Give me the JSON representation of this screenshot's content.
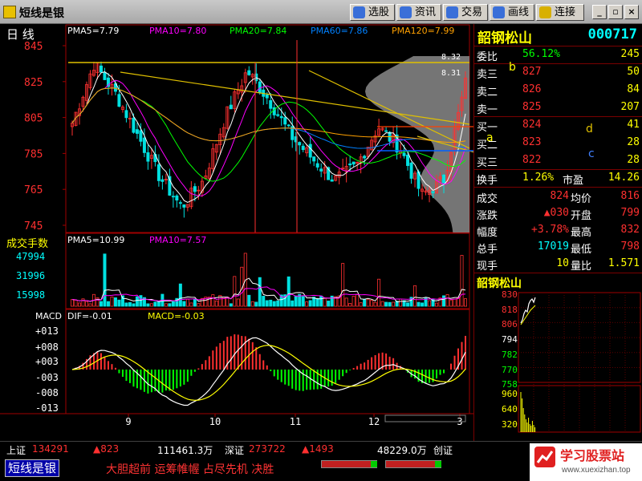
{
  "app": {
    "title": "短线是银"
  },
  "toolbar": {
    "buttons": [
      {
        "label": "选股",
        "icon": "stock-picker-icon",
        "color": "#3a6fd8"
      },
      {
        "label": "资讯",
        "icon": "news-icon",
        "color": "#3a6fd8"
      },
      {
        "label": "交易",
        "icon": "trade-icon",
        "color": "#3a6fd8"
      },
      {
        "label": "画线",
        "icon": "draw-line-icon",
        "color": "#3a6fd8"
      },
      {
        "label": "连接",
        "icon": "connect-icon",
        "color": "#d8b000"
      }
    ],
    "window": {
      "minimize": "_",
      "restore": "▫",
      "close": "×"
    }
  },
  "kline": {
    "period": "日  线",
    "ma_labels": [
      {
        "text": "PMA5=7.79",
        "color": "#ffffff"
      },
      {
        "text": "PMA10=7.80",
        "color": "#ff00ff"
      },
      {
        "text": "PMA20=7.84",
        "color": "#00ff00"
      },
      {
        "text": "PMA60=7.86",
        "color": "#0080ff"
      },
      {
        "text": "PMA120=7.99",
        "color": "#ffa000"
      }
    ],
    "axis_ticks": [
      "845",
      "825",
      "805",
      "785",
      "765",
      "745"
    ],
    "axis_values": [
      8.45,
      8.25,
      8.05,
      7.85,
      7.65,
      7.45
    ],
    "annotations": [
      "8.32",
      "8.31"
    ],
    "line_letters": [
      "a",
      "b",
      "c",
      "d"
    ]
  },
  "volume": {
    "title": "成交手数",
    "ma_labels": [
      {
        "text": "PMA5=10.99",
        "color": "#ffffff"
      },
      {
        "text": "PMA10=7.57",
        "color": "#ff00ff"
      }
    ],
    "axis_ticks": [
      "47994",
      "31996",
      "15998"
    ]
  },
  "macd": {
    "title": "MACD",
    "dif_label": "DIF=-0.01",
    "macd_label": "MACD=-0.03",
    "axis_ticks": [
      "+013",
      "+008",
      "+003",
      "-003",
      "-008",
      "-013"
    ]
  },
  "x_axis": {
    "labels": [
      "9",
      "10",
      "11",
      "12",
      "3"
    ]
  },
  "stock": {
    "name": "韶钢松山",
    "code": "000717"
  },
  "quote": {
    "weibi_label": "委比",
    "weibi_value": "56.12%",
    "weibi_right": "245",
    "sell": [
      {
        "label": "卖三",
        "price": "827",
        "vol": "50"
      },
      {
        "label": "卖二",
        "price": "826",
        "vol": "84"
      },
      {
        "label": "卖一",
        "price": "825",
        "vol": "207"
      }
    ],
    "buy": [
      {
        "label": "买一",
        "price": "824",
        "vol": "41"
      },
      {
        "label": "买二",
        "price": "823",
        "vol": "28"
      },
      {
        "label": "买三",
        "price": "822",
        "vol": "28"
      }
    ],
    "turnover_label": "换手",
    "turnover_value": "1.26%",
    "pe_label": "市盈",
    "pe_value": "14.26",
    "rows": [
      {
        "l1": "成交",
        "v1": "824",
        "l2": "均价",
        "v2": "816",
        "c1": "#ff3030",
        "c2": "#ff3030"
      },
      {
        "l1": "涨跌",
        "v1": "▲030",
        "l2": "开盘",
        "v2": "799",
        "c1": "#ff3030",
        "c2": "#ff3030"
      },
      {
        "l1": "幅度",
        "v1": "+3.78%",
        "l2": "最高",
        "v2": "832",
        "c1": "#ff3030",
        "c2": "#ff3030"
      },
      {
        "l1": "总手",
        "v1": "17019",
        "l2": "最低",
        "v2": "798",
        "c1": "#00ffff",
        "c2": "#ff3030"
      },
      {
        "l1": "现手",
        "v1": "10",
        "l2": "量比",
        "v2": "1.571",
        "c1": "#ffff00",
        "c2": "#ffff00"
      }
    ]
  },
  "mini_chart": {
    "title": "韶钢松山",
    "price_ticks": [
      {
        "text": "830",
        "color": "#ff3030"
      },
      {
        "text": "818",
        "color": "#ff3030"
      },
      {
        "text": "806",
        "color": "#ff3030"
      },
      {
        "text": "794",
        "color": "#ffffff"
      },
      {
        "text": "782",
        "color": "#00ff00"
      },
      {
        "text": "770",
        "color": "#00ff00"
      },
      {
        "text": "758",
        "color": "#00ff00"
      }
    ],
    "vol_ticks": [
      "960",
      "640",
      "320"
    ]
  },
  "status": {
    "sh_label": "上证",
    "sh_value": "134291",
    "sh_change": "▲823",
    "sh_amount": "111461.3万",
    "sz_label": "深证",
    "sz_value": "273722",
    "sz_change": "▲1493",
    "sz_amount": "48229.0万",
    "sz_suffix": "创证"
  },
  "ticker": {
    "button": "短线是银",
    "news": "大胆超前 运筹帷幄 占尽先机 决胜"
  },
  "brand": {
    "name": "学习股票站",
    "url": "www.xuexizhan.top"
  }
}
